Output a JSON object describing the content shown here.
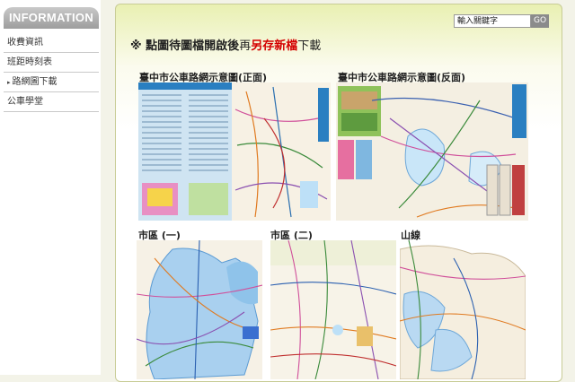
{
  "sidebar": {
    "header": "INFORMATION",
    "items": [
      {
        "label": "收費資訊"
      },
      {
        "label": "班距時刻表"
      },
      {
        "label": "路網圖下載",
        "active_marker": "▸"
      },
      {
        "label": "公車學堂"
      }
    ]
  },
  "search": {
    "placeholder": "輸入關鍵字",
    "button_label": "GO"
  },
  "notice": {
    "mark": "※",
    "text_bold": "點圖待圖檔開啟後",
    "text_normal_1": "再",
    "text_red": "另存新檔",
    "text_normal_2": "下載"
  },
  "maps": [
    {
      "label": "臺中市公車路網示意圖(正面)"
    },
    {
      "label": "臺中市公車路網示意圖(反面)"
    },
    {
      "label": "市區 (一)"
    },
    {
      "label": "市區 (二)"
    },
    {
      "label": "山線"
    }
  ],
  "colors": {
    "accent_red": "#d40000",
    "panel_green": "#e9f0b2",
    "tab_gray": "#a8a8a8"
  }
}
